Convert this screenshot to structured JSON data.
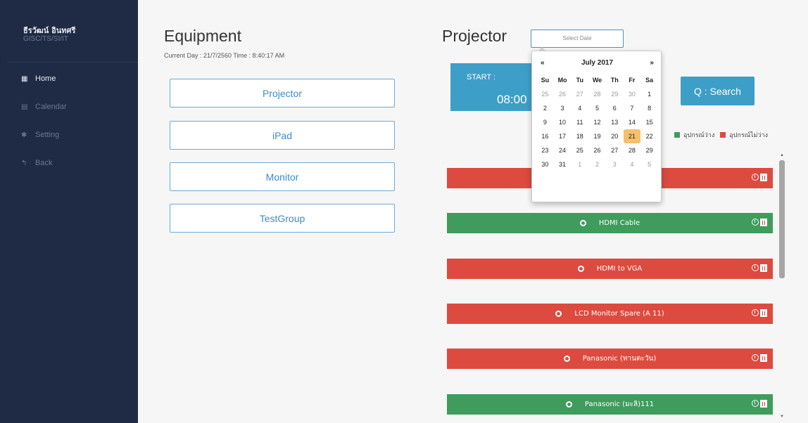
{
  "sidebar": {
    "user_name": "ธีรวัฒน์ อินทศรี",
    "user_dept": "GISC/TS/SI/IT",
    "items": [
      {
        "icon": "grid-icon",
        "label": "Home"
      },
      {
        "icon": "calendar-icon",
        "label": "Calendar"
      },
      {
        "icon": "gear-icon",
        "label": "Setting"
      },
      {
        "icon": "back-arrow-icon",
        "label": "Back"
      }
    ]
  },
  "equipment": {
    "title": "Equipment",
    "current": "Current  Day :  21/7/2560  Time :  8:40:17 AM",
    "categories": [
      "Projector",
      "iPad",
      "Monitor",
      "TestGroup"
    ]
  },
  "projector": {
    "title": "Projector",
    "date_placeholder": "Select Date",
    "start_label": "START :",
    "start_time": "08:00",
    "search_label": "Q : Search",
    "legend": [
      {
        "label": "อุปกรณ์ว่าง",
        "color": "#3f9c5d"
      },
      {
        "label": "อุปกรณ์ไม่ว่าง",
        "color": "#dd4a3f"
      }
    ],
    "items": [
      {
        "label": "",
        "status": "red"
      },
      {
        "label": "HDMI Cable",
        "status": "green"
      },
      {
        "label": "HDMI to VGA",
        "status": "red"
      },
      {
        "label": "LCD Monitor Spare (A 11)",
        "status": "red"
      },
      {
        "label": "Panasonic (ทานตะวัน)",
        "status": "red"
      },
      {
        "label": "Panasonic (มะลิ)111",
        "status": "green"
      }
    ]
  },
  "datepicker": {
    "prev": "«",
    "month_label": "July 2017",
    "next": "»",
    "weekdays": [
      "Su",
      "Mo",
      "Tu",
      "We",
      "Th",
      "Fr",
      "Sa"
    ],
    "weeks": [
      [
        "25",
        "26",
        "27",
        "28",
        "29",
        "30",
        "1"
      ],
      [
        "2",
        "3",
        "4",
        "5",
        "6",
        "7",
        "8"
      ],
      [
        "9",
        "10",
        "11",
        "12",
        "13",
        "14",
        "15"
      ],
      [
        "16",
        "17",
        "18",
        "19",
        "20",
        "21",
        "22"
      ],
      [
        "23",
        "24",
        "25",
        "26",
        "27",
        "28",
        "29"
      ],
      [
        "30",
        "31",
        "1",
        "2",
        "3",
        "4",
        "5"
      ]
    ],
    "today": "21"
  },
  "colors": {
    "sidebar_bg": "#1f2a44",
    "accent_blue": "#3d9fc7",
    "available_green": "#3f9c5d",
    "busy_red": "#dd4a3f",
    "today_highlight": "#f5c06a"
  }
}
